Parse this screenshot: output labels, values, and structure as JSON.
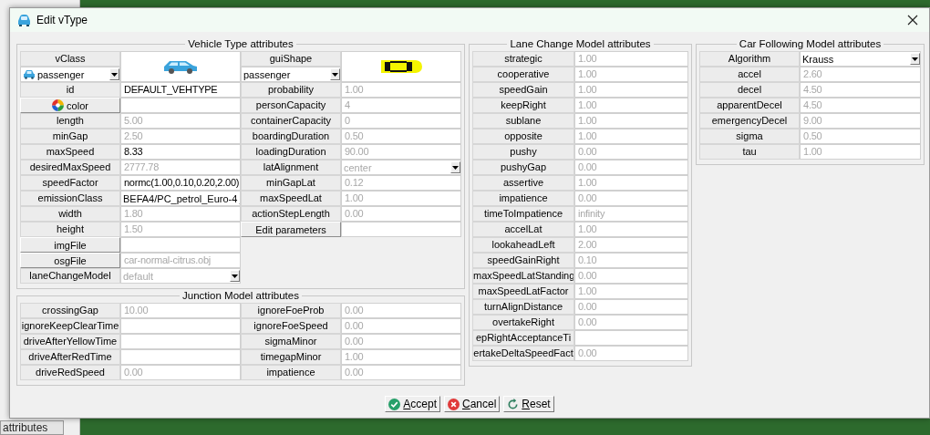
{
  "window": {
    "title": "Edit vType"
  },
  "background": {
    "tab": "attributes"
  },
  "vehicle_panel": {
    "title": "Vehicle Type attributes",
    "vclass": {
      "label": "vClass",
      "value": "passenger"
    },
    "gui_shape": {
      "label": "guiShape",
      "value": "passenger"
    },
    "rows": [
      {
        "left": {
          "label": "id",
          "value": "DEFAULT_VEHTYPE",
          "kind": "field",
          "dimmed": false
        },
        "right": {
          "label": "probability",
          "value": "1.00",
          "kind": "field",
          "dimmed": true
        }
      },
      {
        "left": {
          "label": "color",
          "kind": "color-button"
        },
        "right": {
          "label": "personCapacity",
          "value": "4",
          "kind": "field",
          "dimmed": true
        }
      },
      {
        "left": {
          "label": "length",
          "value": "5.00",
          "kind": "field",
          "dimmed": true
        },
        "right": {
          "label": "containerCapacity",
          "value": "0",
          "kind": "field",
          "dimmed": true
        }
      },
      {
        "left": {
          "label": "minGap",
          "value": "2.50",
          "kind": "field",
          "dimmed": true
        },
        "right": {
          "label": "boardingDuration",
          "value": "0.50",
          "kind": "field",
          "dimmed": true
        }
      },
      {
        "left": {
          "label": "maxSpeed",
          "value": "8.33",
          "kind": "field",
          "dimmed": false
        },
        "right": {
          "label": "loadingDuration",
          "value": "90.00",
          "kind": "field",
          "dimmed": true
        }
      },
      {
        "left": {
          "label": "desiredMaxSpeed",
          "value": "2777.78",
          "kind": "field",
          "dimmed": true
        },
        "right": {
          "label": "latAlignment",
          "value": "center",
          "kind": "select",
          "dimmed": true
        }
      },
      {
        "left": {
          "label": "speedFactor",
          "value": "normc(1.00,0.10,0.20,2.00)",
          "kind": "field",
          "dimmed": false
        },
        "right": {
          "label": "minGapLat",
          "value": "0.12",
          "kind": "field",
          "dimmed": true
        }
      },
      {
        "left": {
          "label": "emissionClass",
          "value": "BEFA4/PC_petrol_Euro-4",
          "kind": "select",
          "dimmed": false
        },
        "right": {
          "label": "maxSpeedLat",
          "value": "1.00",
          "kind": "field",
          "dimmed": true
        }
      },
      {
        "left": {
          "label": "width",
          "value": "1.80",
          "kind": "field",
          "dimmed": true
        },
        "right": {
          "label": "actionStepLength",
          "value": "0.00",
          "kind": "field",
          "dimmed": true
        }
      },
      {
        "left": {
          "label": "height",
          "value": "1.50",
          "kind": "field",
          "dimmed": true
        },
        "right": {
          "label": "Edit parameters",
          "kind": "button"
        }
      },
      {
        "left": {
          "label": "imgFile",
          "kind": "button"
        }
      },
      {
        "left": {
          "label": "osgFile",
          "value": "car-normal-citrus.obj",
          "kind": "button",
          "dimmed": true
        }
      },
      {
        "left": {
          "label": "laneChangeModel",
          "value": "default",
          "kind": "select",
          "dimmed": true
        }
      }
    ]
  },
  "junction_panel": {
    "title": "Junction Model attributes",
    "rows": [
      {
        "left": {
          "label": "crossingGap",
          "value": "10.00",
          "dimmed": true
        },
        "right": {
          "label": "ignoreFoeProb",
          "value": "0.00",
          "dimmed": true
        }
      },
      {
        "left": {
          "label": "ignoreKeepClearTime"
        },
        "right": {
          "label": "ignoreFoeSpeed",
          "value": "0.00",
          "dimmed": true
        }
      },
      {
        "left": {
          "label": "driveAfterYellowTime"
        },
        "right": {
          "label": "sigmaMinor",
          "value": "0.00",
          "dimmed": true
        }
      },
      {
        "left": {
          "label": "driveAfterRedTime"
        },
        "right": {
          "label": "timegapMinor",
          "value": "1.00",
          "dimmed": true
        }
      },
      {
        "left": {
          "label": "driveRedSpeed",
          "value": "0.00",
          "dimmed": true
        },
        "right": {
          "label": "impatience",
          "value": "0.00",
          "dimmed": true
        }
      }
    ]
  },
  "lane_change_panel": {
    "title": "Lane Change Model attributes",
    "fields": [
      {
        "label": "strategic",
        "value": "1.00",
        "dimmed": true
      },
      {
        "label": "cooperative",
        "value": "1.00",
        "dimmed": true
      },
      {
        "label": "speedGain",
        "value": "1.00",
        "dimmed": true
      },
      {
        "label": "keepRight",
        "value": "1.00",
        "dimmed": true
      },
      {
        "label": "sublane",
        "value": "1.00",
        "dimmed": true
      },
      {
        "label": "opposite",
        "value": "1.00",
        "dimmed": true
      },
      {
        "label": "pushy",
        "value": "0.00",
        "dimmed": true
      },
      {
        "label": "pushyGap",
        "value": "0.00",
        "dimmed": true
      },
      {
        "label": "assertive",
        "value": "1.00",
        "dimmed": true
      },
      {
        "label": "impatience",
        "value": "0.00",
        "dimmed": true
      },
      {
        "label": "timeToImpatience",
        "value": "infinity",
        "dimmed": true
      },
      {
        "label": "accelLat",
        "value": "1.00",
        "dimmed": true
      },
      {
        "label": "lookaheadLeft",
        "value": "2.00",
        "dimmed": true
      },
      {
        "label": "speedGainRight",
        "value": "0.10",
        "dimmed": true
      },
      {
        "label": "maxSpeedLatStanding",
        "value": "0.00",
        "dimmed": true
      },
      {
        "label": "maxSpeedLatFactor",
        "value": "1.00",
        "dimmed": true
      },
      {
        "label": "turnAlignDistance",
        "value": "0.00",
        "dimmed": true
      },
      {
        "label": "overtakeRight",
        "value": "0.00",
        "dimmed": true
      },
      {
        "label": "epRightAcceptanceTi"
      },
      {
        "label": "ertakeDeltaSpeedFact",
        "value": "0.00",
        "dimmed": true
      }
    ]
  },
  "car_following_panel": {
    "title": "Car Following Model attributes",
    "fields": [
      {
        "label": "Algorithm",
        "value": "Krauss",
        "kind": "select",
        "dimmed": false
      },
      {
        "label": "accel",
        "value": "2.60",
        "kind": "field",
        "dimmed": true
      },
      {
        "label": "decel",
        "value": "4.50",
        "kind": "field",
        "dimmed": true
      },
      {
        "label": "apparentDecel",
        "value": "4.50",
        "kind": "field",
        "dimmed": true
      },
      {
        "label": "emergencyDecel",
        "value": "9.00",
        "kind": "field",
        "dimmed": true
      },
      {
        "label": "sigma",
        "value": "0.50",
        "kind": "field",
        "dimmed": true
      },
      {
        "label": "tau",
        "value": "1.00",
        "kind": "field",
        "dimmed": true
      }
    ]
  },
  "buttons": [
    {
      "label": "Accept",
      "kind": "accept"
    },
    {
      "label": "Cancel",
      "kind": "cancel"
    },
    {
      "label": "Reset",
      "kind": "reset"
    }
  ]
}
